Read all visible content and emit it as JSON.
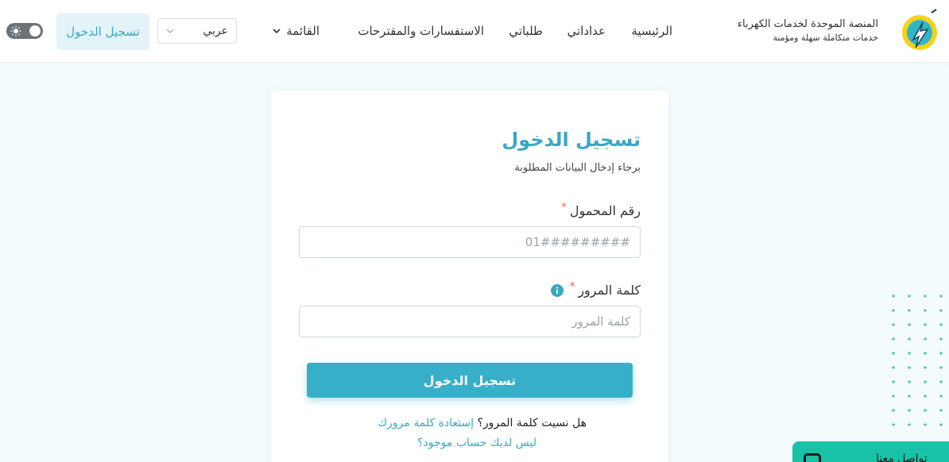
{
  "header": {
    "brand_title": "المنصة الموحدة لخدمات الكهرباء",
    "brand_subtitle": "خدمات متكاملة سهلة ومؤمنة",
    "nav": {
      "home": "الرئيسية",
      "meters": "عداداتي",
      "orders": "طلباتي",
      "inquiries": "الاستفسارات والمقترحات",
      "menu": "القائمة"
    },
    "language": {
      "selected": "عربي"
    },
    "login_button": "تسجيل الدخول"
  },
  "login_form": {
    "title": "تسجيل الدخول",
    "subtitle": "برجاء إدخال البيانات المطلوبة",
    "phone": {
      "label": "رقم المحمول",
      "required_mark": "*",
      "placeholder": "01#########"
    },
    "password": {
      "label": "كلمة المرور",
      "required_mark": "*",
      "placeholder": "كلمة المرور"
    },
    "submit": "تسجيل الدخول",
    "forgot_question": "هل نسيت كلمة المرور؟",
    "forgot_link": "إستعادة كلمة مرورك",
    "no_account": "ليس لديك حساب موجود؟"
  },
  "chat_widget": {
    "label": "تواصل معنا"
  },
  "colors": {
    "accent": "#3aa8c4",
    "button": "#37afc9",
    "required": "#e25a5a",
    "chat": "#18c2a6",
    "background": "#f4fbfc"
  },
  "icons": [
    "logo-icon",
    "chevron-down-icon",
    "sun-icon",
    "info-icon",
    "chat-icon",
    "dot-pattern"
  ]
}
